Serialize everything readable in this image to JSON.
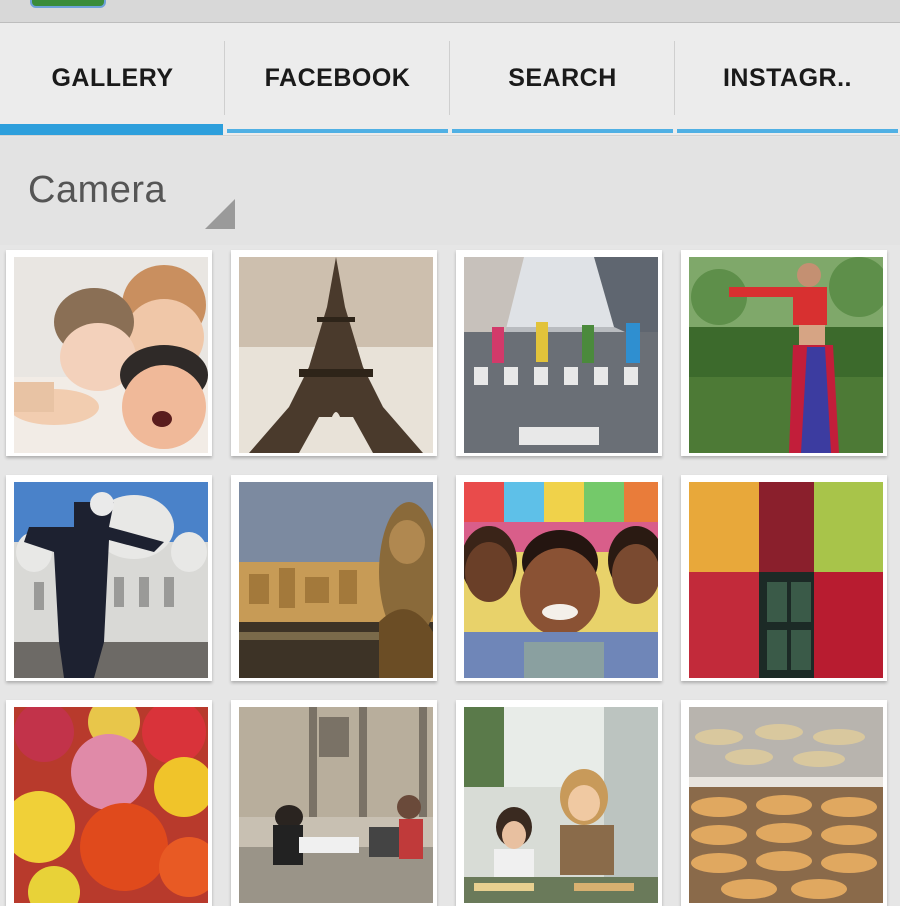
{
  "tabs": [
    {
      "label": "GALLERY",
      "active": true
    },
    {
      "label": "FACEBOOK",
      "active": false
    },
    {
      "label": "SEARCH",
      "active": false
    },
    {
      "label": "INSTAGR.."
    }
  ],
  "album_selector": {
    "selected": "Camera"
  },
  "photos": [
    {
      "name": "children-splashing-photo"
    },
    {
      "name": "eiffel-tower-photo"
    },
    {
      "name": "street-crosswalk-photo"
    },
    {
      "name": "dancer-in-red-photo"
    },
    {
      "name": "sacre-coeur-photo"
    },
    {
      "name": "paris-skyline-photo"
    },
    {
      "name": "smiling-boys-photo"
    },
    {
      "name": "fruit-market-photo"
    },
    {
      "name": "flower-bouquet-photo"
    },
    {
      "name": "plaza-people-photo"
    },
    {
      "name": "cafe-girls-photo"
    },
    {
      "name": "bakery-bread-photo"
    }
  ],
  "colors": {
    "accent": "#2d9fdc",
    "tab_indicator": "#50b0e4"
  }
}
